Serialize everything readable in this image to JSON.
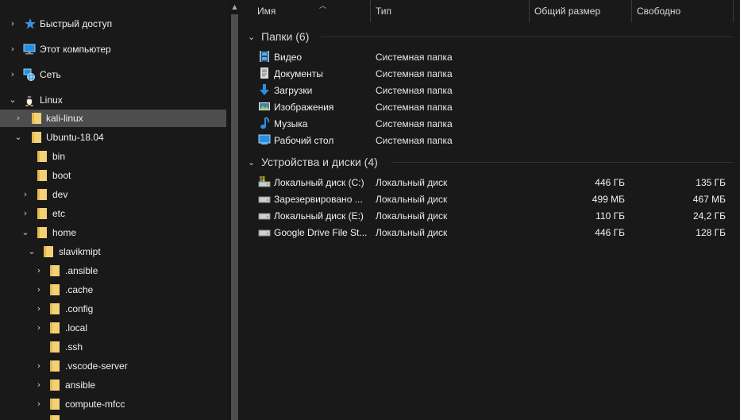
{
  "nav": {
    "items": [
      {
        "label": "Быстрый доступ",
        "icon": "star-icon"
      },
      {
        "label": "Этот компьютер",
        "icon": "computer-icon"
      },
      {
        "label": "Сеть",
        "icon": "network-icon"
      },
      {
        "label": "Linux",
        "icon": "linux-penguin-icon"
      },
      {
        "label": "kali-linux",
        "icon": "folder-icon"
      },
      {
        "label": "Ubuntu-18.04",
        "icon": "folder-icon"
      },
      {
        "label": "bin",
        "icon": "folder-icon"
      },
      {
        "label": "boot",
        "icon": "folder-icon"
      },
      {
        "label": "dev",
        "icon": "folder-icon"
      },
      {
        "label": "etc",
        "icon": "folder-icon"
      },
      {
        "label": "home",
        "icon": "folder-icon"
      },
      {
        "label": "slavikmipt",
        "icon": "folder-icon"
      },
      {
        "label": ".ansible",
        "icon": "folder-icon"
      },
      {
        "label": ".cache",
        "icon": "folder-icon"
      },
      {
        "label": ".config",
        "icon": "folder-icon"
      },
      {
        "label": ".local",
        "icon": "folder-icon"
      },
      {
        "label": ".ssh",
        "icon": "folder-icon"
      },
      {
        "label": ".vscode-server",
        "icon": "folder-icon"
      },
      {
        "label": "ansible",
        "icon": "folder-icon"
      },
      {
        "label": "compute-mfcc",
        "icon": "folder-icon"
      }
    ]
  },
  "columns": {
    "name": "Имя",
    "type": "Тип",
    "total": "Общий размер",
    "free": "Свободно"
  },
  "groups": {
    "folders": {
      "title": "Папки (6)",
      "items": [
        {
          "name": "Видео",
          "type": "Системная папка",
          "icon": "video-icon"
        },
        {
          "name": "Документы",
          "type": "Системная папка",
          "icon": "documents-icon"
        },
        {
          "name": "Загрузки",
          "type": "Системная папка",
          "icon": "download-arrow-icon"
        },
        {
          "name": "Изображения",
          "type": "Системная папка",
          "icon": "pictures-icon"
        },
        {
          "name": "Музыка",
          "type": "Системная папка",
          "icon": "music-note-icon"
        },
        {
          "name": "Рабочий стол",
          "type": "Системная папка",
          "icon": "desktop-icon"
        }
      ]
    },
    "drives": {
      "title": "Устройства и диски (4)",
      "items": [
        {
          "name": "Локальный диск (C:)",
          "type": "Локальный диск",
          "total": "446 ГБ",
          "free": "135 ГБ",
          "icon": "system-drive-icon"
        },
        {
          "name": "Зарезервировано ...",
          "type": "Локальный диск",
          "total": "499 МБ",
          "free": "467 МБ",
          "icon": "drive-icon"
        },
        {
          "name": "Локальный диск (E:)",
          "type": "Локальный диск",
          "total": "110 ГБ",
          "free": "24,2 ГБ",
          "icon": "drive-icon"
        },
        {
          "name": "Google Drive File St...",
          "type": "Локальный диск",
          "total": "446 ГБ",
          "free": "128 ГБ",
          "icon": "drive-icon"
        }
      ]
    }
  },
  "colors": {
    "background": "#191919",
    "selected": "#4d4d4d",
    "folder": "#f3d177",
    "accent": "#2b8fe0"
  }
}
